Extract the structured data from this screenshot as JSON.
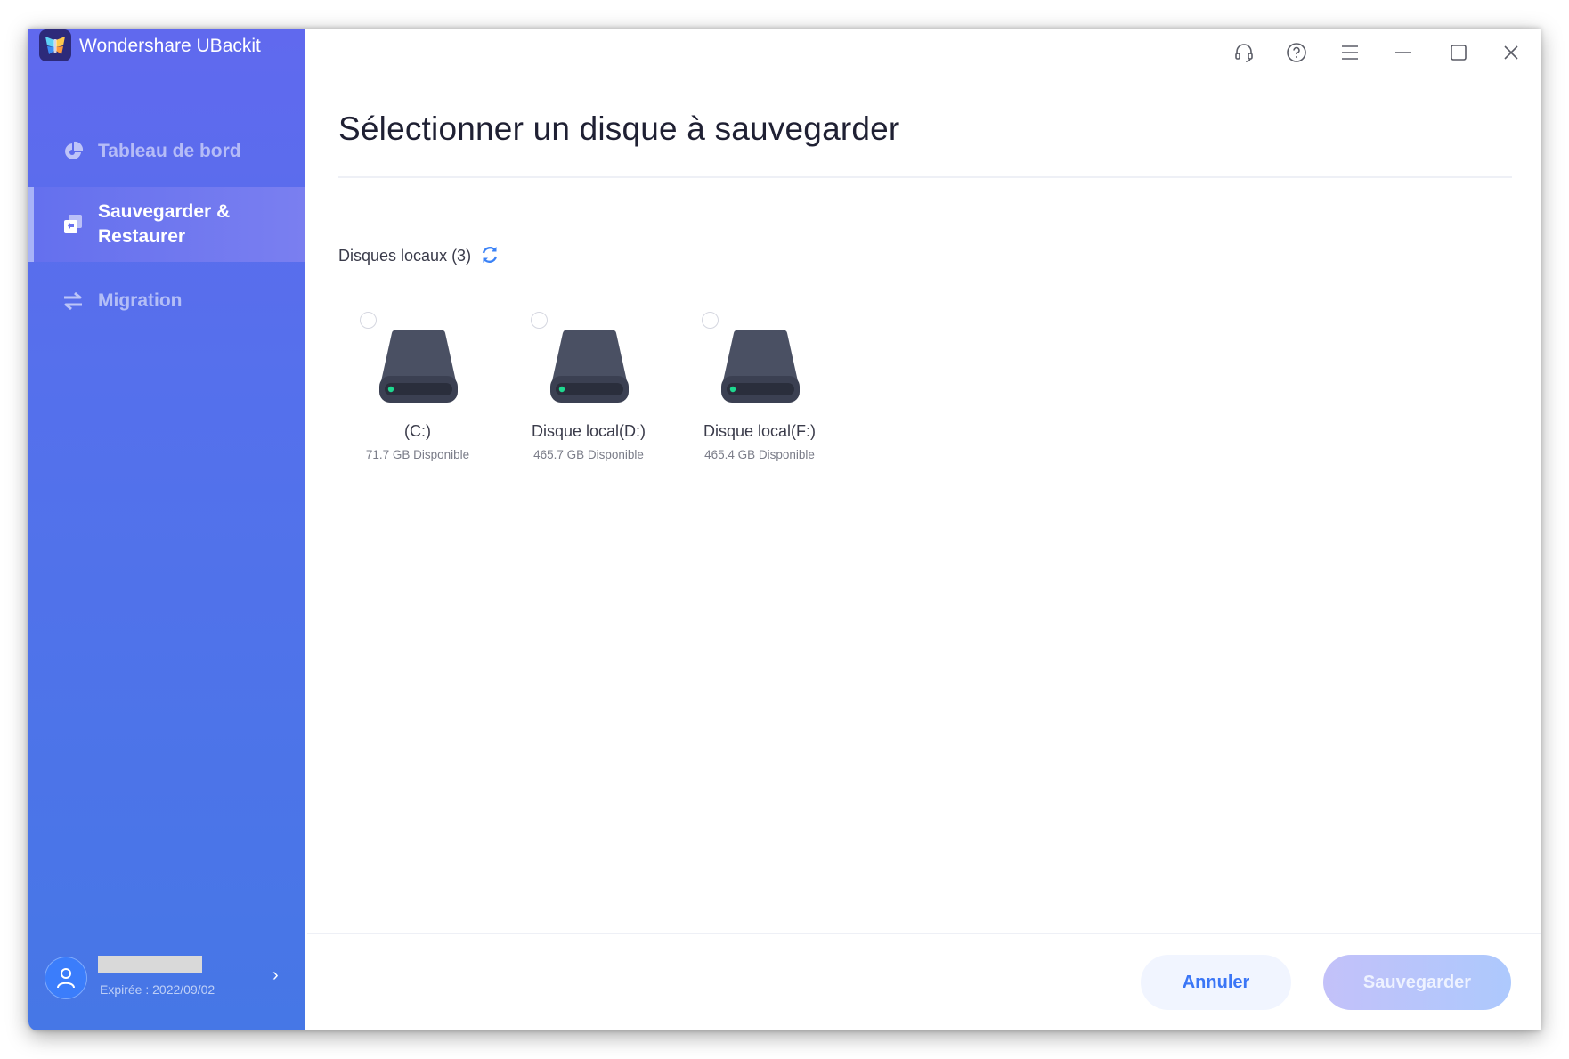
{
  "app": {
    "title": "Wondershare UBackit",
    "logo_icon": "butterfly-logo-icon"
  },
  "sidebar": {
    "items": [
      {
        "label": "Tableau de bord",
        "icon": "pie-chart-icon",
        "active": false
      },
      {
        "label": "Sauvegarder & Restaurer",
        "label_line1": "Sauvegarder &",
        "label_line2": "Restaurer",
        "icon": "backup-restore-icon",
        "active": true
      },
      {
        "label": "Migration",
        "icon": "swap-arrows-icon",
        "active": false
      }
    ],
    "user": {
      "name": "",
      "expiry": "Expirée : 2022/09/02",
      "chevron": "›"
    }
  },
  "window_controls": [
    {
      "name": "support",
      "icon": "headset-icon"
    },
    {
      "name": "help",
      "icon": "help-circle-icon"
    },
    {
      "name": "menu",
      "icon": "hamburger-menu-icon"
    },
    {
      "name": "minimize",
      "icon": "minimize-icon"
    },
    {
      "name": "maximize",
      "icon": "maximize-icon"
    },
    {
      "name": "close",
      "icon": "close-icon"
    }
  ],
  "main": {
    "title": "Sélectionner un disque à sauvegarder",
    "section_label": "Disques locaux (3)",
    "disks": [
      {
        "name": "(C:)",
        "free": "71.7 GB Disponible",
        "selected": false
      },
      {
        "name": "Disque local(D:)",
        "free": "465.7 GB Disponible",
        "selected": false
      },
      {
        "name": "Disque local(F:)",
        "free": "465.4 GB Disponible",
        "selected": false
      }
    ]
  },
  "footer": {
    "cancel_label": "Annuler",
    "save_label": "Sauvegarder",
    "save_enabled": false
  },
  "colors": {
    "sidebar_top": "#6069ee",
    "sidebar_bottom": "#4677e6",
    "accent": "#3b76f6",
    "drive_body": "#4a5063",
    "drive_led": "#1ed88f"
  }
}
